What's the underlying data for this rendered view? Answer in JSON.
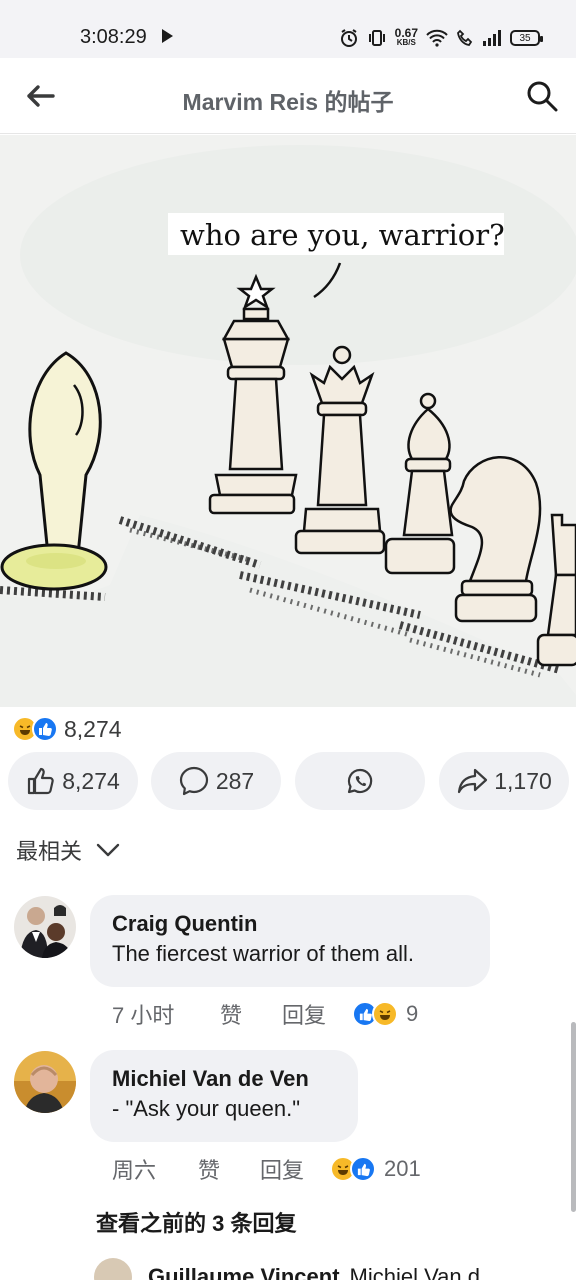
{
  "status_bar": {
    "time": "3:08:29",
    "net_speed_value": "0.67",
    "net_speed_unit": "KB/S",
    "battery": "35"
  },
  "header": {
    "title": "Marvim Reis 的帖子"
  },
  "post": {
    "image_caption_text": "who are you, warrior?",
    "reaction_count": "8,274",
    "actions": {
      "like_count": "8,274",
      "comment_count": "287",
      "share_count": "1,170"
    }
  },
  "sort": {
    "label": "最相关"
  },
  "comments": [
    {
      "author": "Craig Quentin",
      "text": "The fiercest warrior of them all.",
      "time": "7 小时",
      "like_label": "赞",
      "reply_label": "回复",
      "reaction_count": "9"
    },
    {
      "author": "Michiel Van de Ven",
      "text": "- \"Ask your queen.\"",
      "time": "周六",
      "like_label": "赞",
      "reply_label": "回复",
      "reaction_count": "201"
    }
  ],
  "view_previous_replies": "查看之前的 3 条回复",
  "partial_reply": {
    "author": "Guillaume Vincent",
    "text": "Michiel Van d"
  },
  "colors": {
    "accent_like": "#1877f2",
    "haha": "#f7b928",
    "pill_bg": "#f0f1f4",
    "secondary_text": "#65676b"
  }
}
